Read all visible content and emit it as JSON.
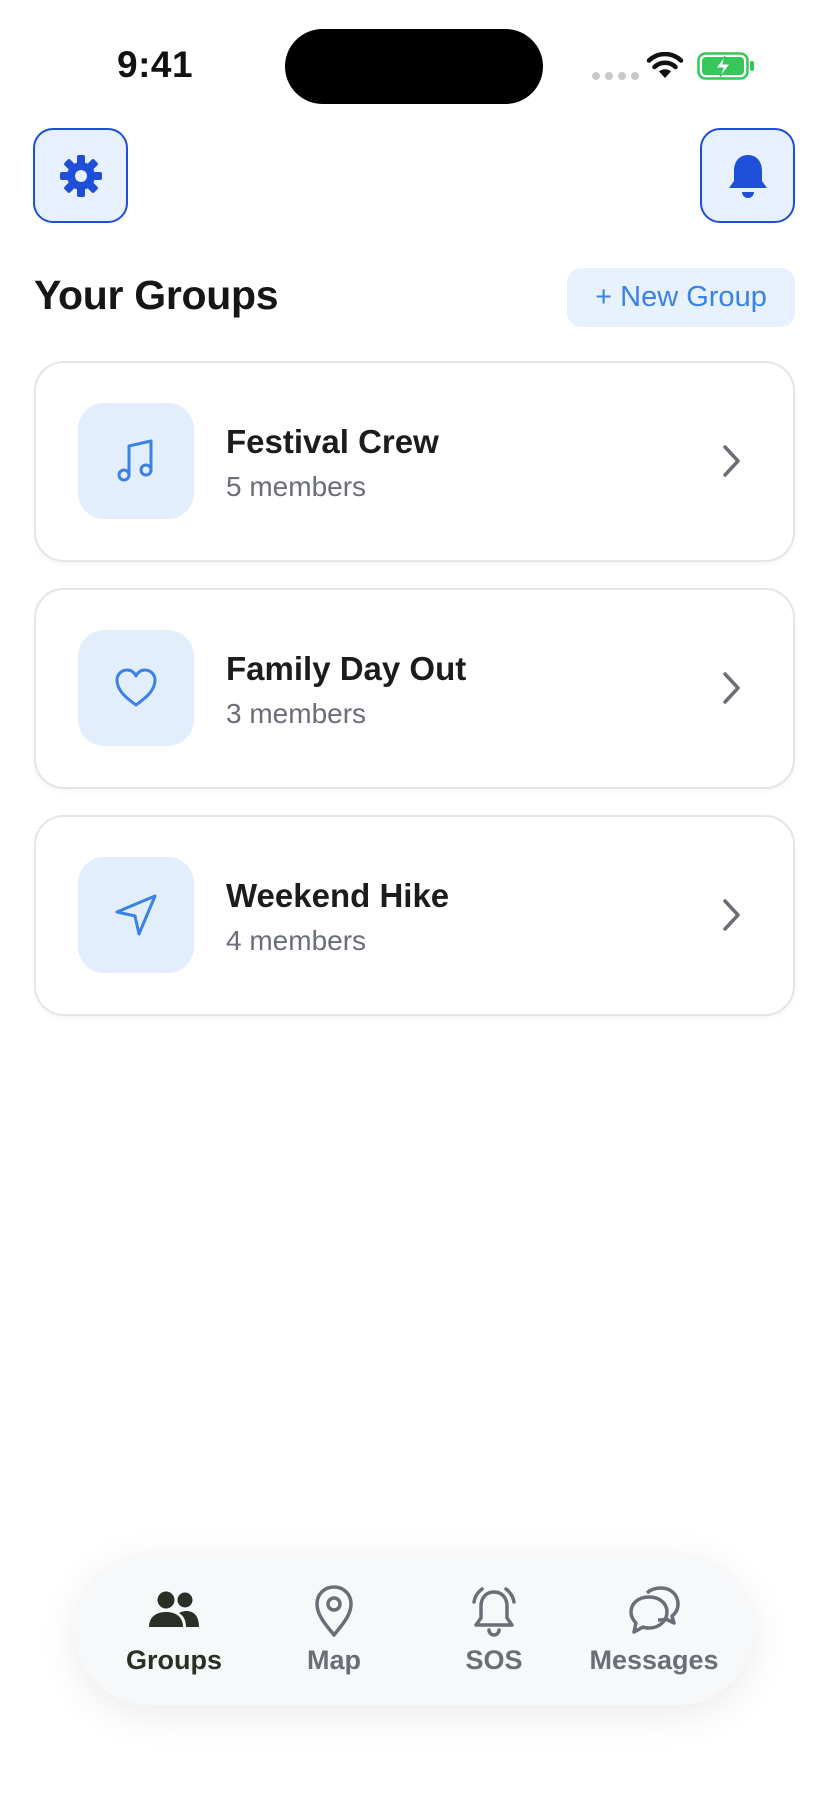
{
  "status_bar": {
    "time": "9:41"
  },
  "header": {
    "settings_icon": "gear-icon",
    "notifications_icon": "bell-icon",
    "title": "Your Groups",
    "new_group_label": "+ New Group"
  },
  "groups": [
    {
      "name": "Festival Crew",
      "members": "5 members",
      "icon": "music-note-icon"
    },
    {
      "name": "Family Day Out",
      "members": "3 members",
      "icon": "heart-icon"
    },
    {
      "name": "Weekend Hike",
      "members": "4 members",
      "icon": "navigation-arrow-icon"
    }
  ],
  "tabbar": {
    "tabs": [
      {
        "label": "Groups",
        "icon": "people-icon",
        "active": true
      },
      {
        "label": "Map",
        "icon": "map-pin-icon",
        "active": false
      },
      {
        "label": "SOS",
        "icon": "alarm-bell-icon",
        "active": false
      },
      {
        "label": "Messages",
        "icon": "chat-bubbles-icon",
        "active": false
      }
    ]
  },
  "colors": {
    "accent": "#1f4ed8",
    "accent_light": "#3b82e6",
    "icon_bg": "#e3eefd",
    "battery_green": "#34c759"
  }
}
